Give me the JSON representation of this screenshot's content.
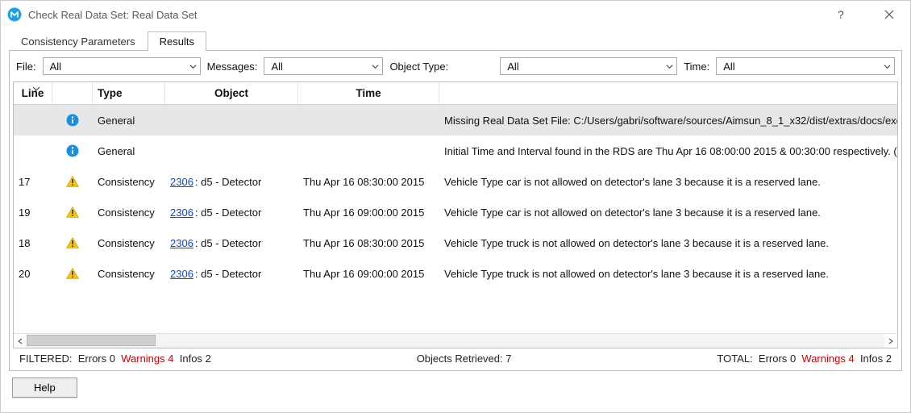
{
  "title": "Check Real Data Set: Real Data Set",
  "tabs": {
    "parameters": "Consistency Parameters",
    "results": "Results"
  },
  "filters": {
    "file_label": "File:",
    "file_value": "All",
    "messages_label": "Messages:",
    "messages_value": "All",
    "objtype_label": "Object Type:",
    "objtype_value": "All",
    "time_label": "Time:",
    "time_value": "All"
  },
  "columns": {
    "line": "Line",
    "type": "Type",
    "object": "Object",
    "time": "Time"
  },
  "rows": [
    {
      "line": "",
      "iconType": "info",
      "type": "General",
      "object_link": "",
      "object_suffix": "",
      "time": "",
      "msg": "Missing Real Data Set File: C:/Users/gabri/software/sources/Aimsun_8_1_x32/dist/extras/docs/exer",
      "highlight": true
    },
    {
      "line": "",
      "iconType": "info",
      "type": "General",
      "object_link": "",
      "object_suffix": "",
      "time": "",
      "msg": "Initial Time and Interval found in the RDS are Thu Apr 16 08:00:00 2015 & 00:30:00 respectively. (F",
      "highlight": false
    },
    {
      "line": "17",
      "iconType": "warn",
      "type": "Consistency",
      "object_link": "2306",
      "object_suffix": ": d5 - Detector",
      "time": "Thu Apr 16 08:30:00 2015",
      "msg": "Vehicle Type car is not allowed on detector's lane 3 because it is a reserved lane.",
      "highlight": false
    },
    {
      "line": "19",
      "iconType": "warn",
      "type": "Consistency",
      "object_link": "2306",
      "object_suffix": ": d5 - Detector",
      "time": "Thu Apr 16 09:00:00 2015",
      "msg": "Vehicle Type car is not allowed on detector's lane 3 because it is a reserved lane.",
      "highlight": false
    },
    {
      "line": "18",
      "iconType": "warn",
      "type": "Consistency",
      "object_link": "2306",
      "object_suffix": ": d5 - Detector",
      "time": "Thu Apr 16 08:30:00 2015",
      "msg": "Vehicle Type truck is not allowed on detector's lane 3 because it is a reserved lane.",
      "highlight": false
    },
    {
      "line": "20",
      "iconType": "warn",
      "type": "Consistency",
      "object_link": "2306",
      "object_suffix": ": d5 - Detector",
      "time": "Thu Apr 16 09:00:00 2015",
      "msg": "Vehicle Type truck is not allowed on detector's lane 3 because it is a reserved lane.",
      "highlight": false
    }
  ],
  "status": {
    "filtered_label": "FILTERED:",
    "filtered_errors_label": "Errors",
    "filtered_errors_value": "0",
    "filtered_warnings_label": "Warnings",
    "filtered_warnings_value": "4",
    "filtered_infos_label": "Infos",
    "filtered_infos_value": "2",
    "objects_retrieved_label": "Objects Retrieved:",
    "objects_retrieved_value": "7",
    "total_label": "TOTAL:",
    "total_errors_label": "Errors",
    "total_errors_value": "0",
    "total_warnings_label": "Warnings",
    "total_warnings_value": "4",
    "total_infos_label": "Infos",
    "total_infos_value": "2"
  },
  "buttons": {
    "help": "Help"
  }
}
